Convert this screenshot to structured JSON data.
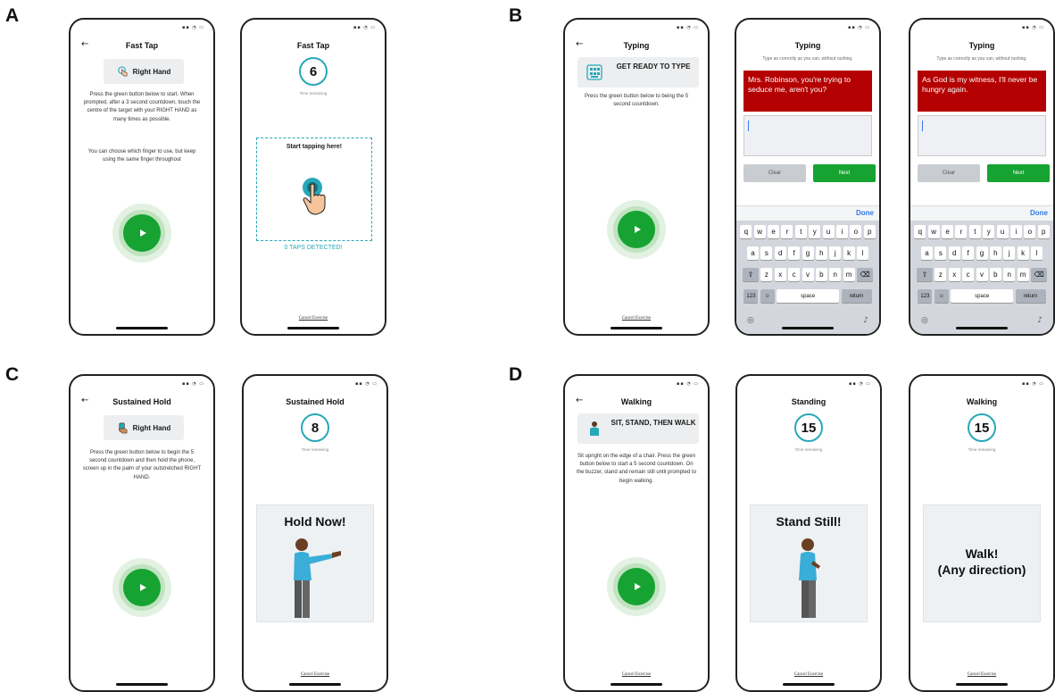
{
  "panels": {
    "A": "A",
    "B": "B",
    "C": "C",
    "D": "D"
  },
  "colors": {
    "accent_green": "#16a331",
    "teal": "#27a8b8",
    "prompt_red": "#b40000",
    "link_blue": "#2f7be5"
  },
  "common": {
    "cancel": "Cancel Exercise",
    "time_remaining": "Time remaining"
  },
  "fast_tap_setup": {
    "title": "Fast Tap",
    "hand": "Right Hand",
    "hand_icon": "tap-hand-icon",
    "para1": "Press the green button below to start. When prompted, after a 3 second countdown, touch the centre of the target with your RIGHT HAND as many times as possible.",
    "para2": "You can choose which finger to use, but keep using the same finger throughout"
  },
  "fast_tap_run": {
    "title": "Fast Tap",
    "timer": "6",
    "zone_label": "Start tapping here!",
    "taps": "0 TAPS DETECTED!"
  },
  "typing_setup": {
    "title": "Typing",
    "ready": "GET READY TO TYPE",
    "instr": "Press the green button below to being the 5 second countdown."
  },
  "typing_run1": {
    "title": "Typing",
    "subtitle": "Type as correctly as you can, without rushing.",
    "prompt": "Mrs. Robinson, you're trying to seduce me, aren't you?",
    "clear": "Clear",
    "next": "Next",
    "done": "Done"
  },
  "typing_run2": {
    "title": "Typing",
    "subtitle": "Type as correctly as you can, without rushing.",
    "prompt": "As God is my witness, I'll never be hungry again.",
    "clear": "Clear",
    "next": "Next",
    "done": "Done"
  },
  "keyboard": {
    "row1": [
      "q",
      "w",
      "e",
      "r",
      "t",
      "y",
      "u",
      "i",
      "o",
      "p"
    ],
    "row2": [
      "a",
      "s",
      "d",
      "f",
      "g",
      "h",
      "j",
      "k",
      "l"
    ],
    "row3": [
      "z",
      "x",
      "c",
      "v",
      "b",
      "n",
      "m"
    ],
    "shift": "⇧",
    "backspace": "⌫",
    "num": "123",
    "emoji": "☺",
    "space": "space",
    "return": "return"
  },
  "hold_setup": {
    "title": "Sustained Hold",
    "hand": "Right Hand",
    "instr": "Press the green button below to begin the 5 second countdown and then hold the phone, screen up in the palm of your outstretched RIGHT HAND."
  },
  "hold_run": {
    "title": "Sustained Hold",
    "timer": "8",
    "scene_text": "Hold Now!"
  },
  "walk_setup": {
    "title": "Walking",
    "ready": "SIT, STAND, THEN WALK",
    "instr": "Sit upright on the edge of a chair. Press the green button below to start a 5 second countdown. On the buzzer, stand and remain still until prompted to begin walking."
  },
  "stand_run": {
    "title": "Standing",
    "timer": "15",
    "scene_text": "Stand Still!"
  },
  "walk_run": {
    "title": "Walking",
    "timer": "15",
    "scene_line1": "Walk!",
    "scene_line2": "(Any direction)"
  }
}
